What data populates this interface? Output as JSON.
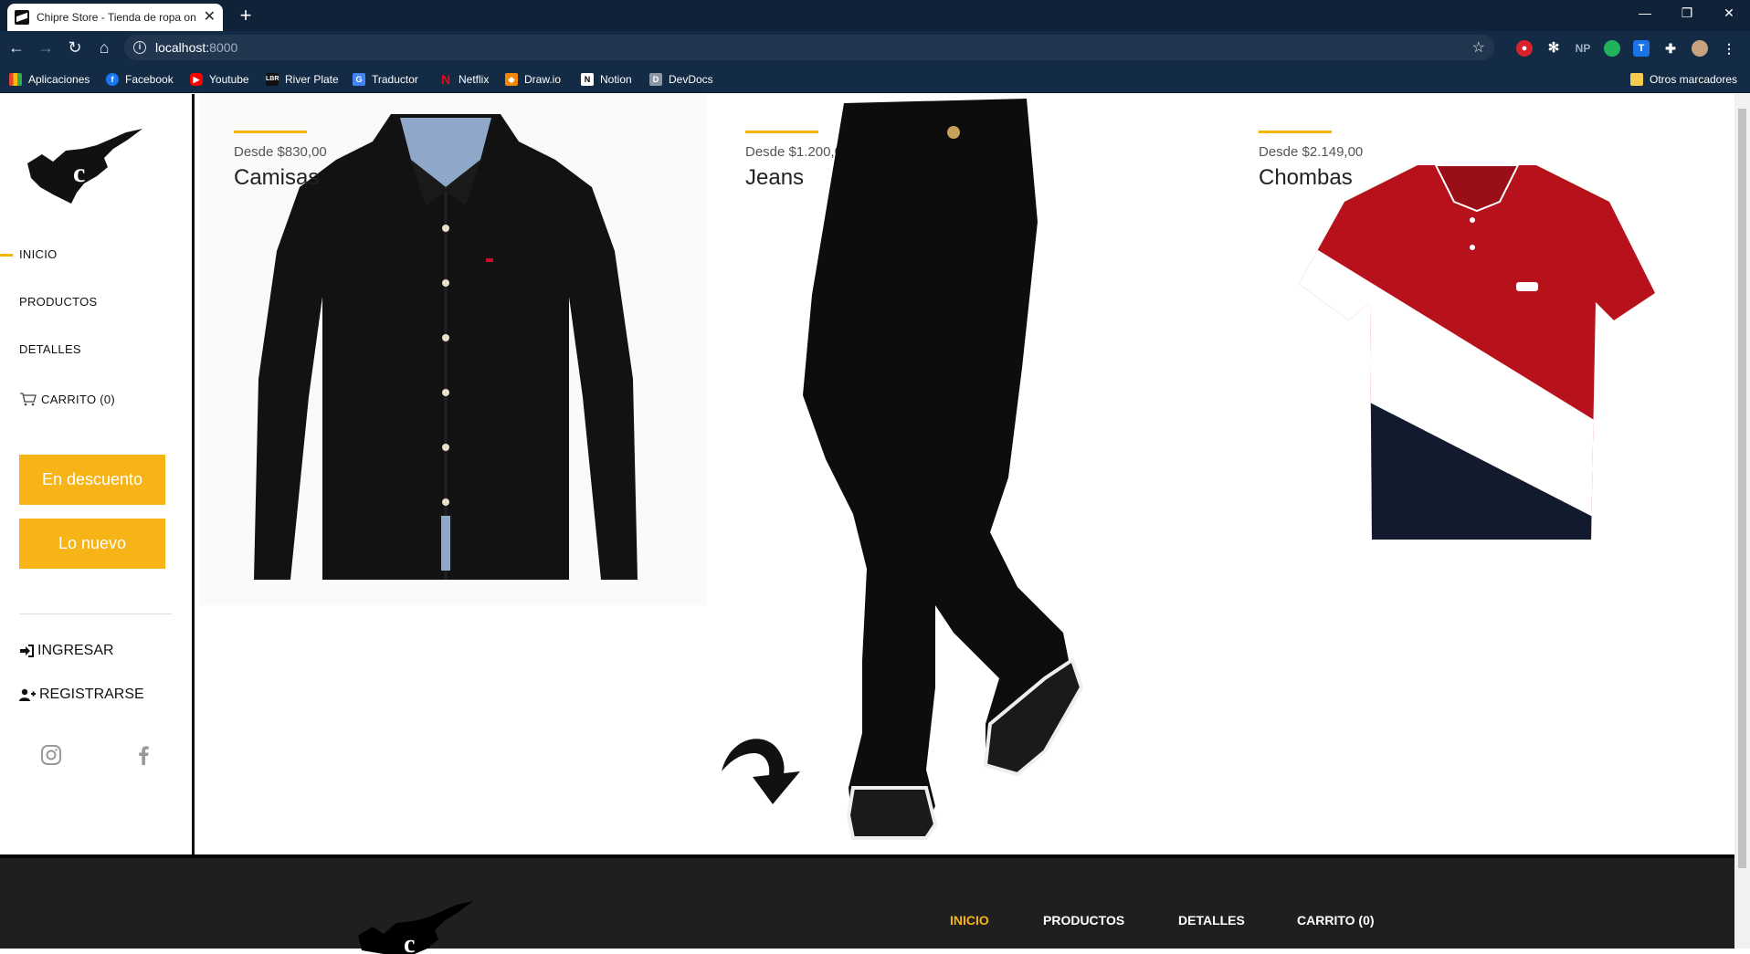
{
  "browser": {
    "tab_title": "Chipre Store - Tienda de ropa on",
    "new_tab": "+",
    "url_host": "localhost:",
    "url_port": "8000",
    "bookmarks": [
      "Aplicaciones",
      "Facebook",
      "Youtube",
      "River Plate",
      "Traductor",
      "Netflix",
      "Draw.io",
      "Notion",
      "DevDocs"
    ],
    "other_bookmarks": "Otros marcadores",
    "extensions": [
      "adblock",
      "settings",
      "NP",
      "green-circle",
      "T",
      "puzzle",
      "avatar",
      "menu"
    ]
  },
  "sidebar": {
    "nav": [
      "INICIO",
      "PRODUCTOS",
      "DETALLES",
      "CARRITO (0)"
    ],
    "active": "INICIO",
    "buttons": [
      "En descuento",
      "Lo nuevo"
    ],
    "login": "INGRESAR",
    "register": "REGISTRARSE",
    "social": [
      "instagram-icon",
      "facebook-icon"
    ]
  },
  "products": [
    {
      "price": "Desde $830,00",
      "name": "Camisas"
    },
    {
      "price": "Desde $1.200,00",
      "name": "Jeans"
    },
    {
      "price": "Desde $2.149,00",
      "name": "Chombas"
    }
  ],
  "footer": {
    "nav": [
      "INICIO",
      "PRODUCTOS",
      "DETALLES",
      "CARRITO (0)"
    ],
    "active": "INICIO"
  },
  "colors": {
    "accent": "#f6b416",
    "browser_bg": "#0f2238",
    "footer_bg": "#1f1f1f"
  }
}
